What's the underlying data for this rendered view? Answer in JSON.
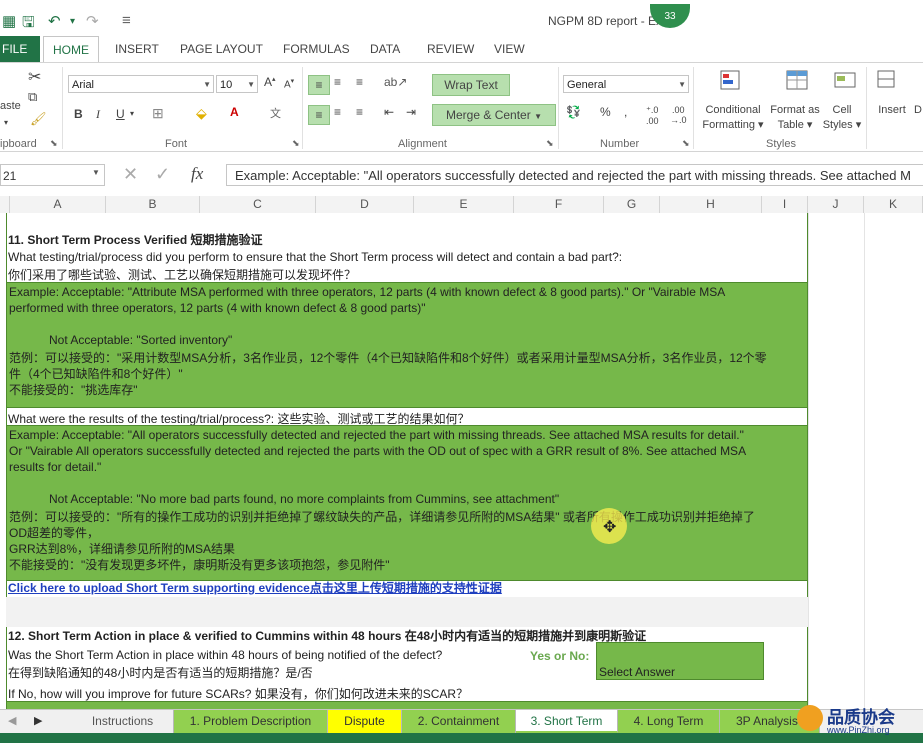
{
  "window": {
    "title": "NGPM 8D report - Ex",
    "notification_count": "33"
  },
  "ribbon_tabs": [
    "FILE",
    "HOME",
    "INSERT",
    "PAGE LAYOUT",
    "FORMULAS",
    "DATA",
    "REVIEW",
    "VIEW"
  ],
  "ribbon": {
    "clipboard": {
      "paste_label": "aste",
      "group_label": "ipboard"
    },
    "font": {
      "font_name": "Arial",
      "font_size": "10",
      "group_label": "Font"
    },
    "alignment": {
      "wrap_text": "Wrap Text",
      "merge_center": "Merge & Center",
      "group_label": "Alignment"
    },
    "number": {
      "format": "General",
      "group_label": "Number"
    },
    "styles": {
      "conditional_formatting": [
        "Conditional",
        "Formatting"
      ],
      "format_as_table": [
        "Format as",
        "Table"
      ],
      "cell_styles": [
        "Cell",
        "Styles"
      ],
      "group_label": "Styles"
    },
    "cells": {
      "insert_label": "Insert",
      "delete_label": "D"
    }
  },
  "formula_bar": {
    "name_box": "21",
    "fx": "fx",
    "formula": "Example: Acceptable: \"All operators successfully detected and rejected the part with missing threads. See attached M"
  },
  "columns": [
    "A",
    "B",
    "C",
    "D",
    "E",
    "F",
    "G",
    "H",
    "I",
    "J",
    "K"
  ],
  "sheet": {
    "section11_title": "11. Short Term Process Verified 短期措施验证",
    "q1_en": "What testing/trial/process did you perform to ensure that the Short Term process will detect and contain a bad part?:",
    "q1_cn": "你们采用了哪些试验、测试、工艺以确保短期措施可以发现坏件？",
    "box1_lines": [
      "Example: Acceptable: \"Attribute MSA performed with three operators, 12 parts (4 with known defect & 8 good parts).\" Or \"Vairable MSA",
      "performed with three operators, 12 parts (4 with known defect & 8 good parts)\"",
      "",
      "            Not Acceptable: \"Sorted inventory\"",
      "范例：可以接受的：\"采用计数型MSA分析，3名作业员，12个零件（4个已知缺陷件和8个好件）或者采用计量型MSA分析，3名作业员，12个零",
      "件（4个已知缺陷件和8个好件）\"",
      "不能接受的：\"挑选库存\""
    ],
    "q2": "What were the results of the testing/trial/process?: 这些实验、测试或工艺的结果如何？",
    "box2_lines": [
      "Example: Acceptable: \"All operators successfully detected and rejected the part with missing threads. See attached MSA results for detail.\"",
      "Or \"Vairable All operators successfully detected and rejected the parts with the OD out of spec with a GRR result of 8%. See attached MSA",
      "results for detail.\"",
      "",
      "            Not Acceptable: \"No more bad parts found, no more complaints from Cummins, see attachment\"",
      "范例：可以接受的：\"所有的操作工成功的识别并拒绝掉了螺纹缺失的产品，详细请参见所附的MSA结果\" 或者所有操作工成功识别并拒绝掉了",
      "OD超差的零件，",
      "GRR达到8%，详细请参见所附的MSA结果",
      "不能接受的：\"没有发现更多坏件，康明斯没有更多该项抱怨，参见附件\""
    ],
    "upload_link": "Click here to upload Short Term supporting evidence点击这里上传短期措施的支持性证据",
    "section12_title": "12. Short Term Action in place & verified to Cummins within 48 hours 在48小时内有适当的短期措施并到康明斯验证",
    "q3_en": "Was the Short Term Action in place within 48 hours of being notified of the defect?",
    "q3_cn": "在得到缺陷通知的48小时内是否有适当的短期措施？是/否",
    "yes_no_label": "Yes or No:",
    "select_answer": "Select Answer",
    "q4": "If No, how will you improve for future SCARs? 如果没有，你们如何改进未来的SCAR？"
  },
  "sheet_tabs": [
    "Instructions",
    "1. Problem Description",
    "Dispute",
    "2. Containment",
    "3. Short Term",
    "4. Long Term",
    "3P Analysis"
  ],
  "active_sheet": "3. Short Term",
  "watermark": {
    "cn": "品质协会",
    "url": "www.PinZhi.org"
  },
  "colors": {
    "excel_green": "#217346",
    "cell_green": "#76b84a",
    "dispute_tab": "#ffff00",
    "tab_green": "#92d050"
  }
}
